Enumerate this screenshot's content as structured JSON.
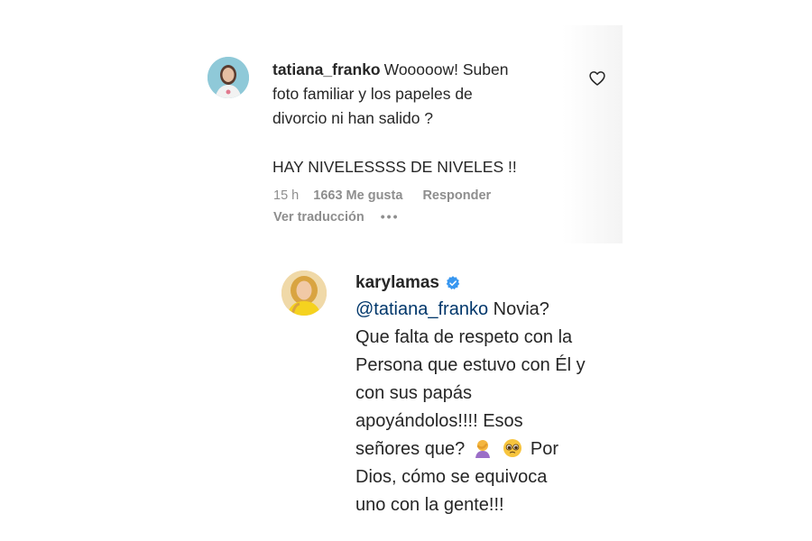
{
  "comment1": {
    "username": "tatiana_franko",
    "text_lines": [
      "Wooooow! Suben",
      "foto familiar y los papeles de",
      "divorcio ni han salido ?",
      "",
      "HAY NIVELESSSS DE NIVELES !!"
    ],
    "time": "15 h",
    "likes": "1663 Me gusta",
    "reply_label": "Responder",
    "translate_label": "Ver traducción",
    "more_label": "•••"
  },
  "comment2": {
    "username": "karylamas",
    "mention": "@tatiana_franko",
    "text_lines": [
      "Novia?",
      "Que falta de respeto con la",
      "Persona que estuvo con Él y",
      "con sus papás",
      "apoyándolos!!!! Esos",
      "señores que?",
      "Por",
      "Dios, cómo se equivoca",
      "uno con la gente!!!"
    ]
  },
  "icons": {
    "like": "heart-icon",
    "verified": "verified-badge-icon",
    "emoji_1": "person-facepalming-emoji",
    "emoji_2": "pleading-face-emoji"
  },
  "colors": {
    "text": "#262626",
    "secondary": "#8e8e8e",
    "mention": "#00376b",
    "verified": "#3897f0"
  }
}
